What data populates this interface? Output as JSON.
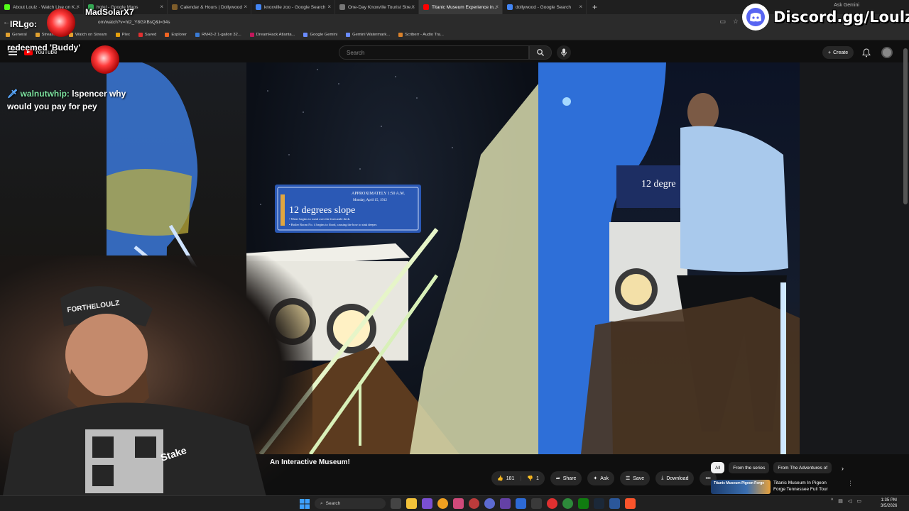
{
  "browser": {
    "tabs": [
      {
        "label": "About Loulz · Watch Live on K...",
        "color": "#53fc18"
      },
      {
        "label": "hotel - Google Maps",
        "color": "#34a853"
      },
      {
        "label": "Calendar & Hours | Dollywood",
        "color": "#7d5c2a"
      },
      {
        "label": "knoxville zoo - Google Search",
        "color": "#4285f4"
      },
      {
        "label": "One-Day Knoxville Tourist Stre...",
        "color": "#777777"
      },
      {
        "label": "Titanic Museum Experience in...",
        "color": "#ff0000",
        "active": true
      },
      {
        "label": "dollywood - Google Search",
        "color": "#4285f4"
      }
    ],
    "new_tab_glyph": "+",
    "ask_gemini": "Ask Gemini",
    "url": "om/watch?v=ht2_Y8GXBsQ&t=34s",
    "bookmarks": [
      {
        "label": "General",
        "color": "#e0a030"
      },
      {
        "label": "Streaming",
        "color": "#e0a030"
      },
      {
        "label": "Watch on Stream",
        "color": "#e0a030"
      },
      {
        "label": "Plex",
        "color": "#e5a00d"
      },
      {
        "label": "Saved",
        "color": "#e03030"
      },
      {
        "label": "Explorer",
        "color": "#f26522"
      },
      {
        "label": "RM43-2 1-gallon 32...",
        "color": "#3a7bd5"
      },
      {
        "label": "DreamHack Atlanta...",
        "color": "#c2185b"
      },
      {
        "label": "Google Gemini",
        "color": "#6a8cff"
      },
      {
        "label": "Gemini Watermark...",
        "color": "#6a8cff"
      },
      {
        "label": "Scriberr - Audio Tra...",
        "color": "#d9812b"
      }
    ]
  },
  "youtube": {
    "logo_text": "YouTube",
    "search_placeholder": "Search",
    "create_label": "Create",
    "video_title": "An Interactive Museum!",
    "like_count": "181",
    "dislike_count": "1",
    "share_label": "Share",
    "ask_label": "Ask",
    "save_label": "Save",
    "download_label": "Download",
    "chips": [
      {
        "label": "All",
        "active": true
      },
      {
        "label": "From the series",
        "active": false
      },
      {
        "label": "From The Adventures of",
        "active": false
      }
    ],
    "recommended": {
      "title": "Titanic Museum In Pigeon Forge Tennessee Full Tour",
      "thumb_text": "Titanic Museum Pigeon Forge"
    },
    "video_sign": {
      "heading": "12 degrees slope",
      "time": "APPROXIMATELY 1:50 A.M.",
      "date": "Monday, April 15, 1912",
      "line1": "• Water begins to wash over the forecastle deck.",
      "line2": "• Boiler Room No. 4 begins to flood, causing the bow to sink deeper."
    },
    "video_sign_right": "12 degre"
  },
  "stream_overlay": {
    "alert_user": "MadSolarX7",
    "irl_label": "IRLgo:",
    "redeem_text": "redeemed 'Buddy'",
    "chat": {
      "username": "walnutwhip:",
      "message": "lspencer why would you pay for pey"
    },
    "discord_text": "Discord.gg/Loulz",
    "cap_text": "FORTHELOULZ",
    "shirt_text": "Stake"
  },
  "taskbar": {
    "search_label": "Search",
    "time": "1:35 PM",
    "date": "3/5/2026"
  }
}
